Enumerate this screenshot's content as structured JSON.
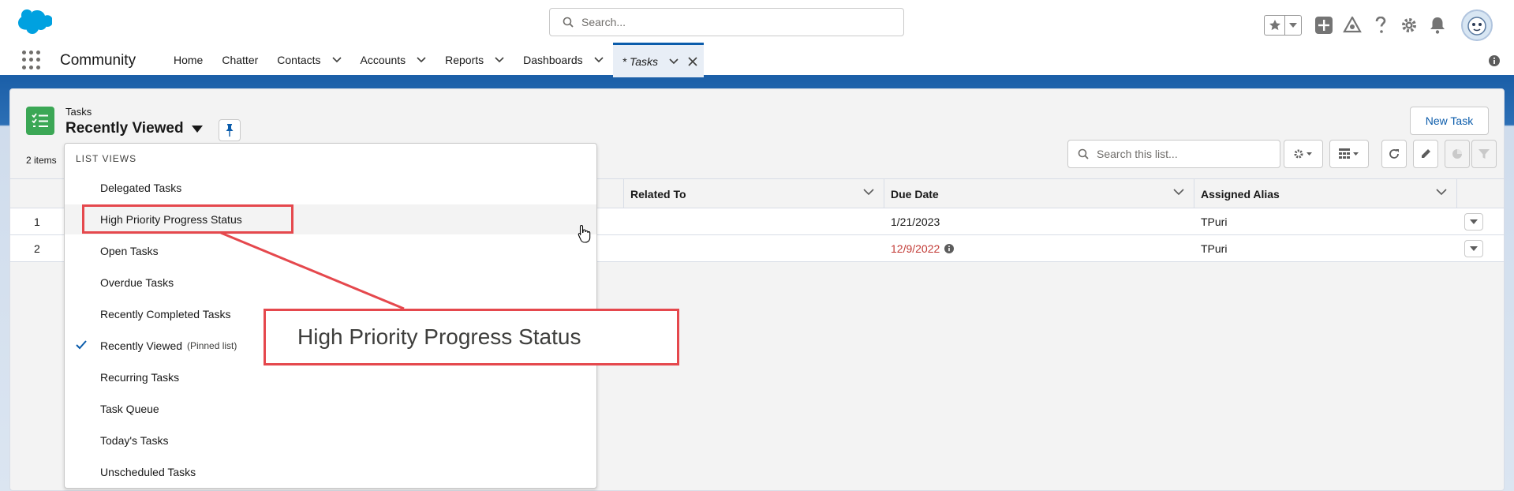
{
  "header": {
    "search_placeholder": "Search...",
    "icons": [
      "salesforce-logo",
      "star-icon",
      "add-icon",
      "trailhead-icon",
      "help-icon",
      "gear-icon",
      "bell-icon",
      "avatar"
    ]
  },
  "nav": {
    "app_name": "Community",
    "items": [
      {
        "label": "Home",
        "has_menu": false
      },
      {
        "label": "Chatter",
        "has_menu": false
      },
      {
        "label": "Contacts",
        "has_menu": true
      },
      {
        "label": "Accounts",
        "has_menu": true
      },
      {
        "label": "Reports",
        "has_menu": true
      },
      {
        "label": "Dashboards",
        "has_menu": true
      }
    ],
    "active_tab": {
      "label": "* Tasks"
    }
  },
  "listview": {
    "object_label": "Tasks",
    "title": "Recently Viewed",
    "item_count": "2 items",
    "new_button": "New Task",
    "search_placeholder": "Search this list..."
  },
  "table": {
    "columns": [
      "Related To",
      "Due Date",
      "Assigned Alias"
    ],
    "rows": [
      {
        "num": "1",
        "due_date": "1/21/2023",
        "alias": "TPuri",
        "overdue": false
      },
      {
        "num": "2",
        "due_date": "12/9/2022",
        "alias": "TPuri",
        "overdue": true
      }
    ]
  },
  "dropdown": {
    "heading": "LIST VIEWS",
    "items": [
      {
        "label": "Delegated Tasks"
      },
      {
        "label": "High Priority Progress Status",
        "hovered": true
      },
      {
        "label": "Open Tasks"
      },
      {
        "label": "Overdue Tasks"
      },
      {
        "label": "Recently Completed Tasks"
      },
      {
        "label": "Recently Viewed",
        "note": "(Pinned list)",
        "selected": true
      },
      {
        "label": "Recurring Tasks"
      },
      {
        "label": "Task Queue"
      },
      {
        "label": "Today's Tasks"
      },
      {
        "label": "Unscheduled Tasks"
      }
    ]
  },
  "annotation": {
    "callout_text": "High Priority Progress Status",
    "color": "#e5484d"
  }
}
